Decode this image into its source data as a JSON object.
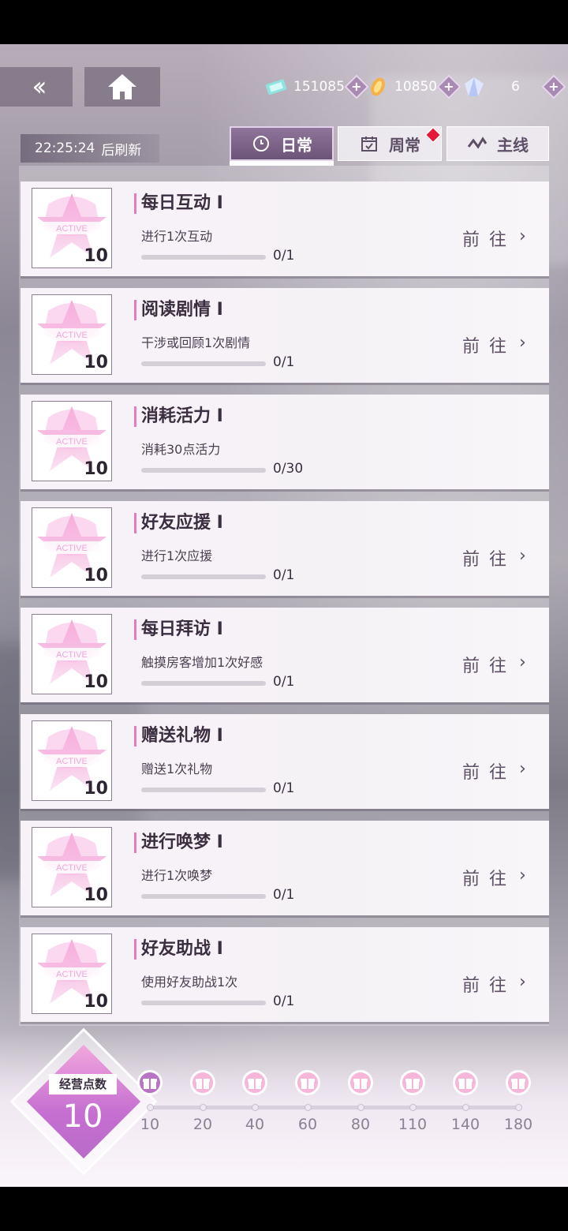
{
  "header": {
    "back_icon": "double-chevron-left-icon",
    "home_icon": "home-icon",
    "currencies": [
      {
        "name": "ticket-currency-icon",
        "value": "151085"
      },
      {
        "name": "feather-currency-icon",
        "value": "10850"
      },
      {
        "name": "crystal-currency-icon",
        "value": "6"
      }
    ]
  },
  "refresh": {
    "time": "22:25:24",
    "suffix": "后刷新"
  },
  "tabs": [
    {
      "label": "日常",
      "icon": "clock-icon",
      "active": true
    },
    {
      "label": "周常",
      "icon": "calendar-icon",
      "active": false,
      "badge": true
    },
    {
      "label": "主线",
      "icon": "route-icon",
      "active": false
    }
  ],
  "tasks": [
    {
      "title": "每日互动 I",
      "desc": "进行1次互动",
      "progress": "0/1",
      "points": "10",
      "goto": "前往",
      "fraction": 0
    },
    {
      "title": "阅读剧情 I",
      "desc": "干涉或回顾1次剧情",
      "progress": "0/1",
      "points": "10",
      "goto": "前往",
      "fraction": 0
    },
    {
      "title": "消耗活力 I",
      "desc": "消耗30点活力",
      "progress": "0/30",
      "points": "10",
      "goto": "",
      "fraction": 0
    },
    {
      "title": "好友应援 I",
      "desc": "进行1次应援",
      "progress": "0/1",
      "points": "10",
      "goto": "前往",
      "fraction": 0
    },
    {
      "title": "每日拜访 I",
      "desc": "触摸房客增加1次好感",
      "progress": "0/1",
      "points": "10",
      "goto": "前往",
      "fraction": 0
    },
    {
      "title": "赠送礼物 I",
      "desc": "赠送1次礼物",
      "progress": "0/1",
      "points": "10",
      "goto": "前往",
      "fraction": 0
    },
    {
      "title": "进行唤梦 I",
      "desc": "进行1次唤梦",
      "progress": "0/1",
      "points": "10",
      "goto": "前往",
      "fraction": 0
    },
    {
      "title": "好友助战 I",
      "desc": "使用好友助战1次",
      "progress": "0/1",
      "points": "10",
      "goto": "前往",
      "fraction": 0
    }
  ],
  "business_points": {
    "label": "经营点数",
    "value": "10",
    "milestones": [
      "10",
      "20",
      "40",
      "60",
      "80",
      "110",
      "140",
      "180"
    ],
    "claimed_count": 1
  },
  "colors": {
    "accent": "#c776b6",
    "tab_active": "#7a6186",
    "badge_red": "#e51a3a"
  }
}
